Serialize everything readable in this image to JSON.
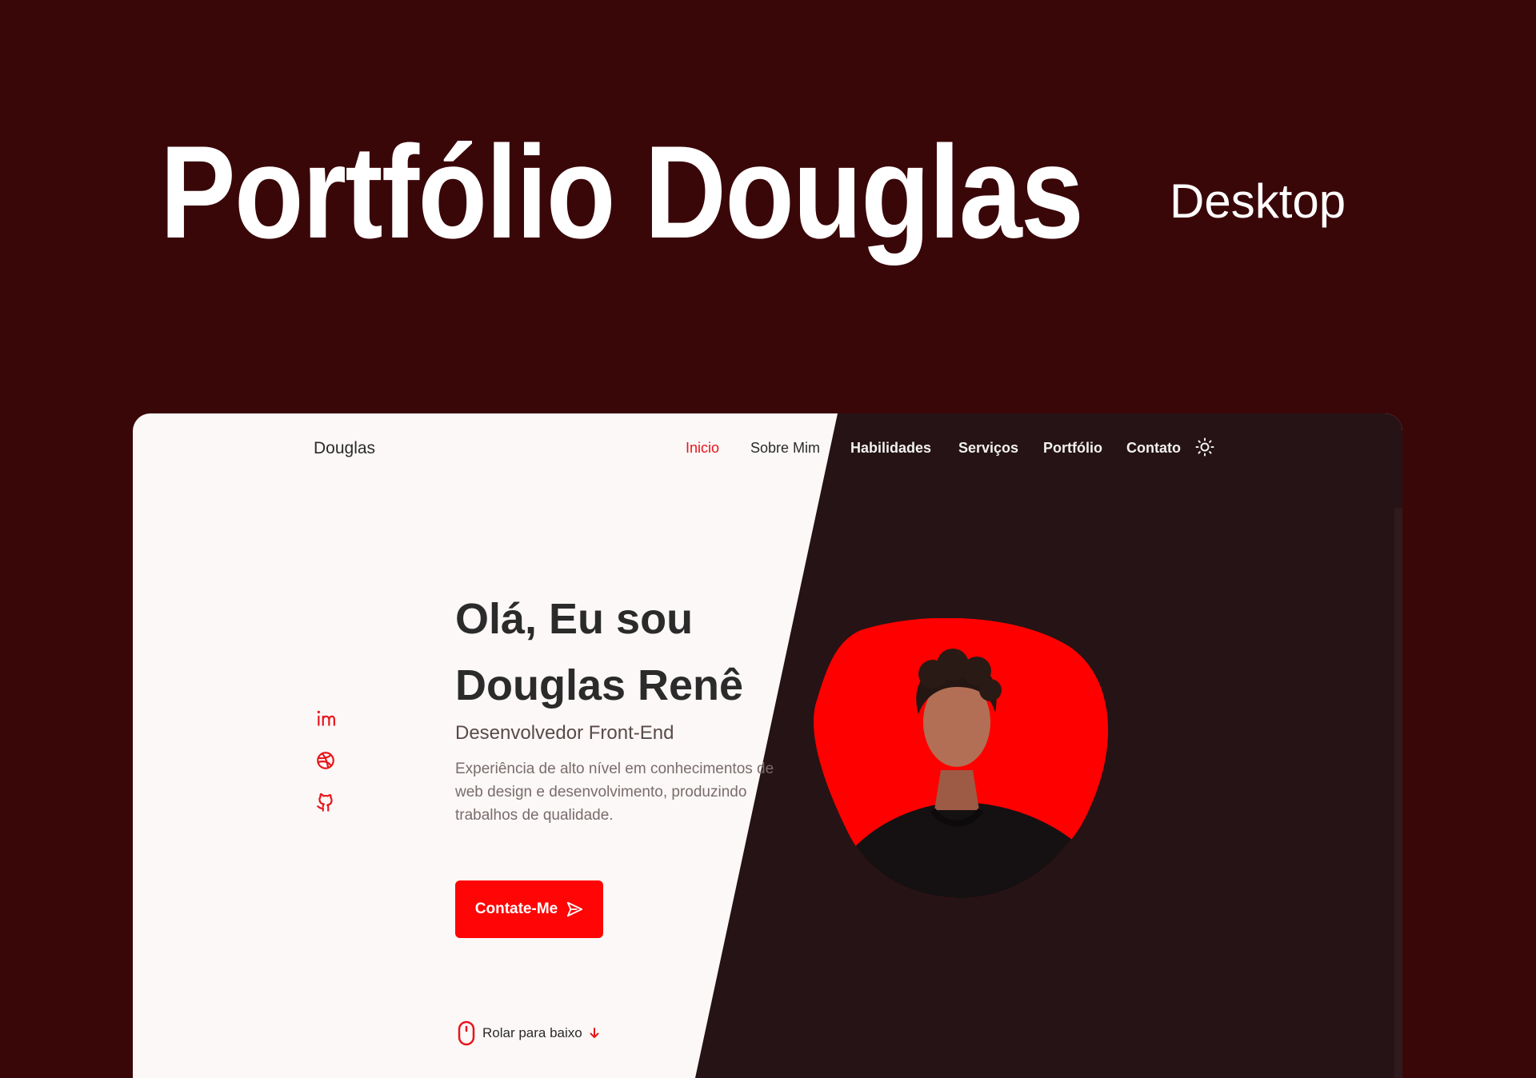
{
  "cover": {
    "title": "Portfólio Douglas",
    "subtitle": "Desktop"
  },
  "site": {
    "logo": "Douglas",
    "nav": {
      "items": [
        {
          "label": "Inicio",
          "active": true
        },
        {
          "label": "Sobre Mim"
        },
        {
          "label": "Habilidades"
        },
        {
          "label": "Serviços"
        },
        {
          "label": "Portfólio"
        },
        {
          "label": "Contato"
        }
      ],
      "theme_icon": "sun-icon"
    },
    "socials": [
      {
        "name": "linkedin",
        "icon": "linkedin-icon"
      },
      {
        "name": "dribbble",
        "icon": "dribbble-icon"
      },
      {
        "name": "github",
        "icon": "github-icon"
      }
    ],
    "home": {
      "heading_line1": "Olá, Eu sou",
      "heading_line2": "Douglas Renê",
      "role": "Desenvolvedor Front-End",
      "description": "Experiência de alto nível em conhecimentos de web design e desenvolvimento, produzindo trabalhos de qualidade.",
      "cta_label": "Contate-Me",
      "cta_icon": "send-icon",
      "scroll_label": "Rolar para baixo",
      "scroll_icons": [
        "mouse-icon",
        "arrow-down-icon"
      ]
    }
  },
  "colors": {
    "background": "#3a0709",
    "accent": "#ff0505",
    "light_bg": "#fbf8f7",
    "dark_bg": "#261315"
  }
}
